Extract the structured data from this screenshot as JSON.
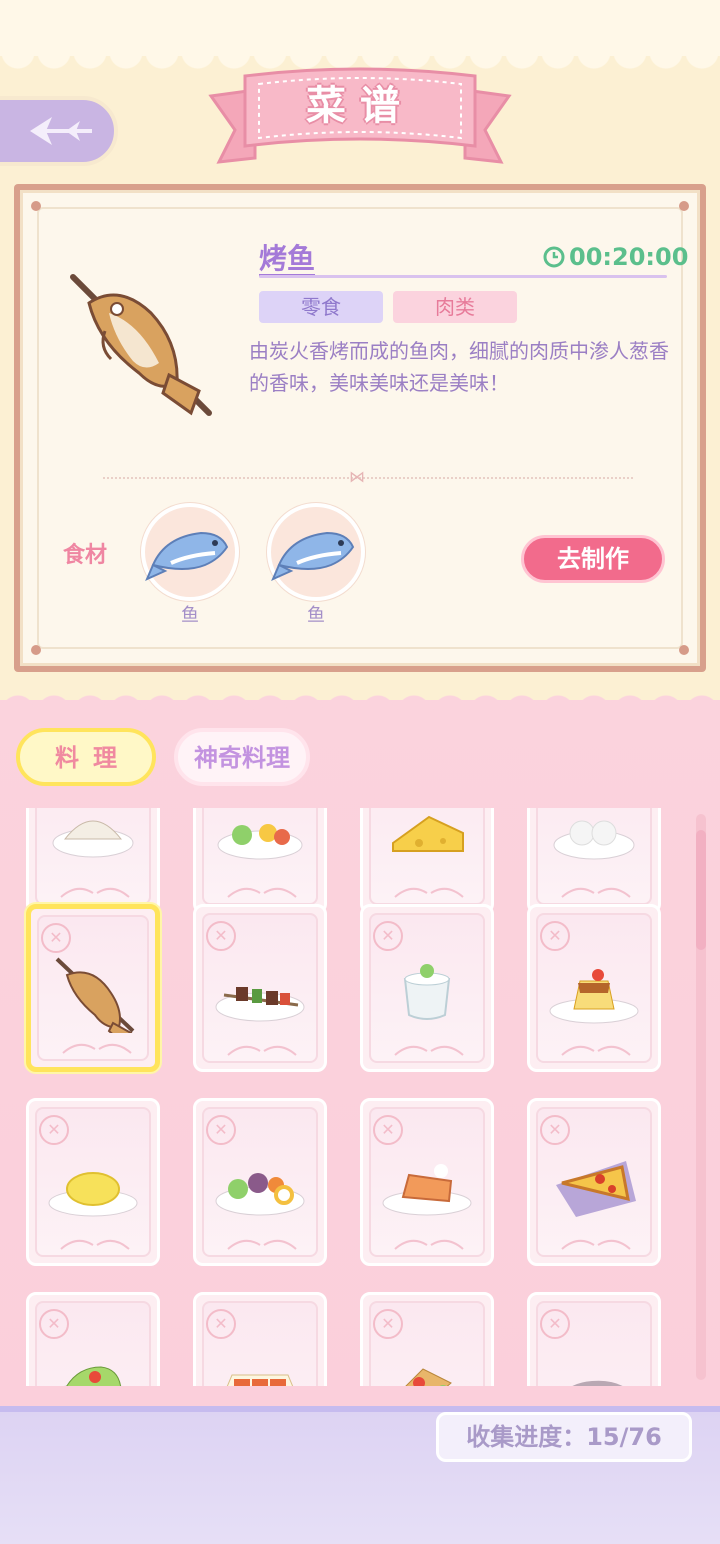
{
  "header": {
    "title": "菜谱",
    "back_icon": "back-arrow-icon"
  },
  "detail": {
    "name": "烤鱼",
    "time": "00:20:00",
    "tags": [
      "零食",
      "肉类"
    ],
    "description": "由炭火香烤而成的鱼肉，细腻的肉质中渗人葱香的香味，美味美味还是美味！",
    "ingredients_label": "食材",
    "ingredients": [
      {
        "name": "鱼",
        "icon": "fish-icon"
      },
      {
        "name": "鱼",
        "icon": "fish-icon"
      }
    ],
    "make_button": "去制作"
  },
  "tabs": [
    {
      "label": "料理",
      "active": true
    },
    {
      "label": "神奇料理",
      "active": false
    }
  ],
  "recipes": [
    {
      "dish": "dumpling-icon"
    },
    {
      "dish": "salad-icon"
    },
    {
      "dish": "cheese-icon"
    },
    {
      "dish": "rice-icon"
    },
    {
      "dish": "grilled-fish-icon",
      "selected": true
    },
    {
      "dish": "kebab-icon"
    },
    {
      "dish": "yogurt-icon"
    },
    {
      "dish": "pudding-icon"
    },
    {
      "dish": "omelette-icon"
    },
    {
      "dish": "salad-egg-icon"
    },
    {
      "dish": "cake-icon"
    },
    {
      "dish": "pizza-icon"
    },
    {
      "dish": "wrap-icon"
    },
    {
      "dish": "roll-icon"
    },
    {
      "dish": "sandwich-icon"
    },
    {
      "dish": "locked-icon"
    }
  ],
  "progress": {
    "text": "收集进度：15/76",
    "collected": 15,
    "total": 76
  },
  "colors": {
    "accent_pink": "#f26b8c",
    "accent_purple": "#a47ad8",
    "timer_green": "#5bbf8c",
    "highlight_yellow": "#ffe45c"
  }
}
